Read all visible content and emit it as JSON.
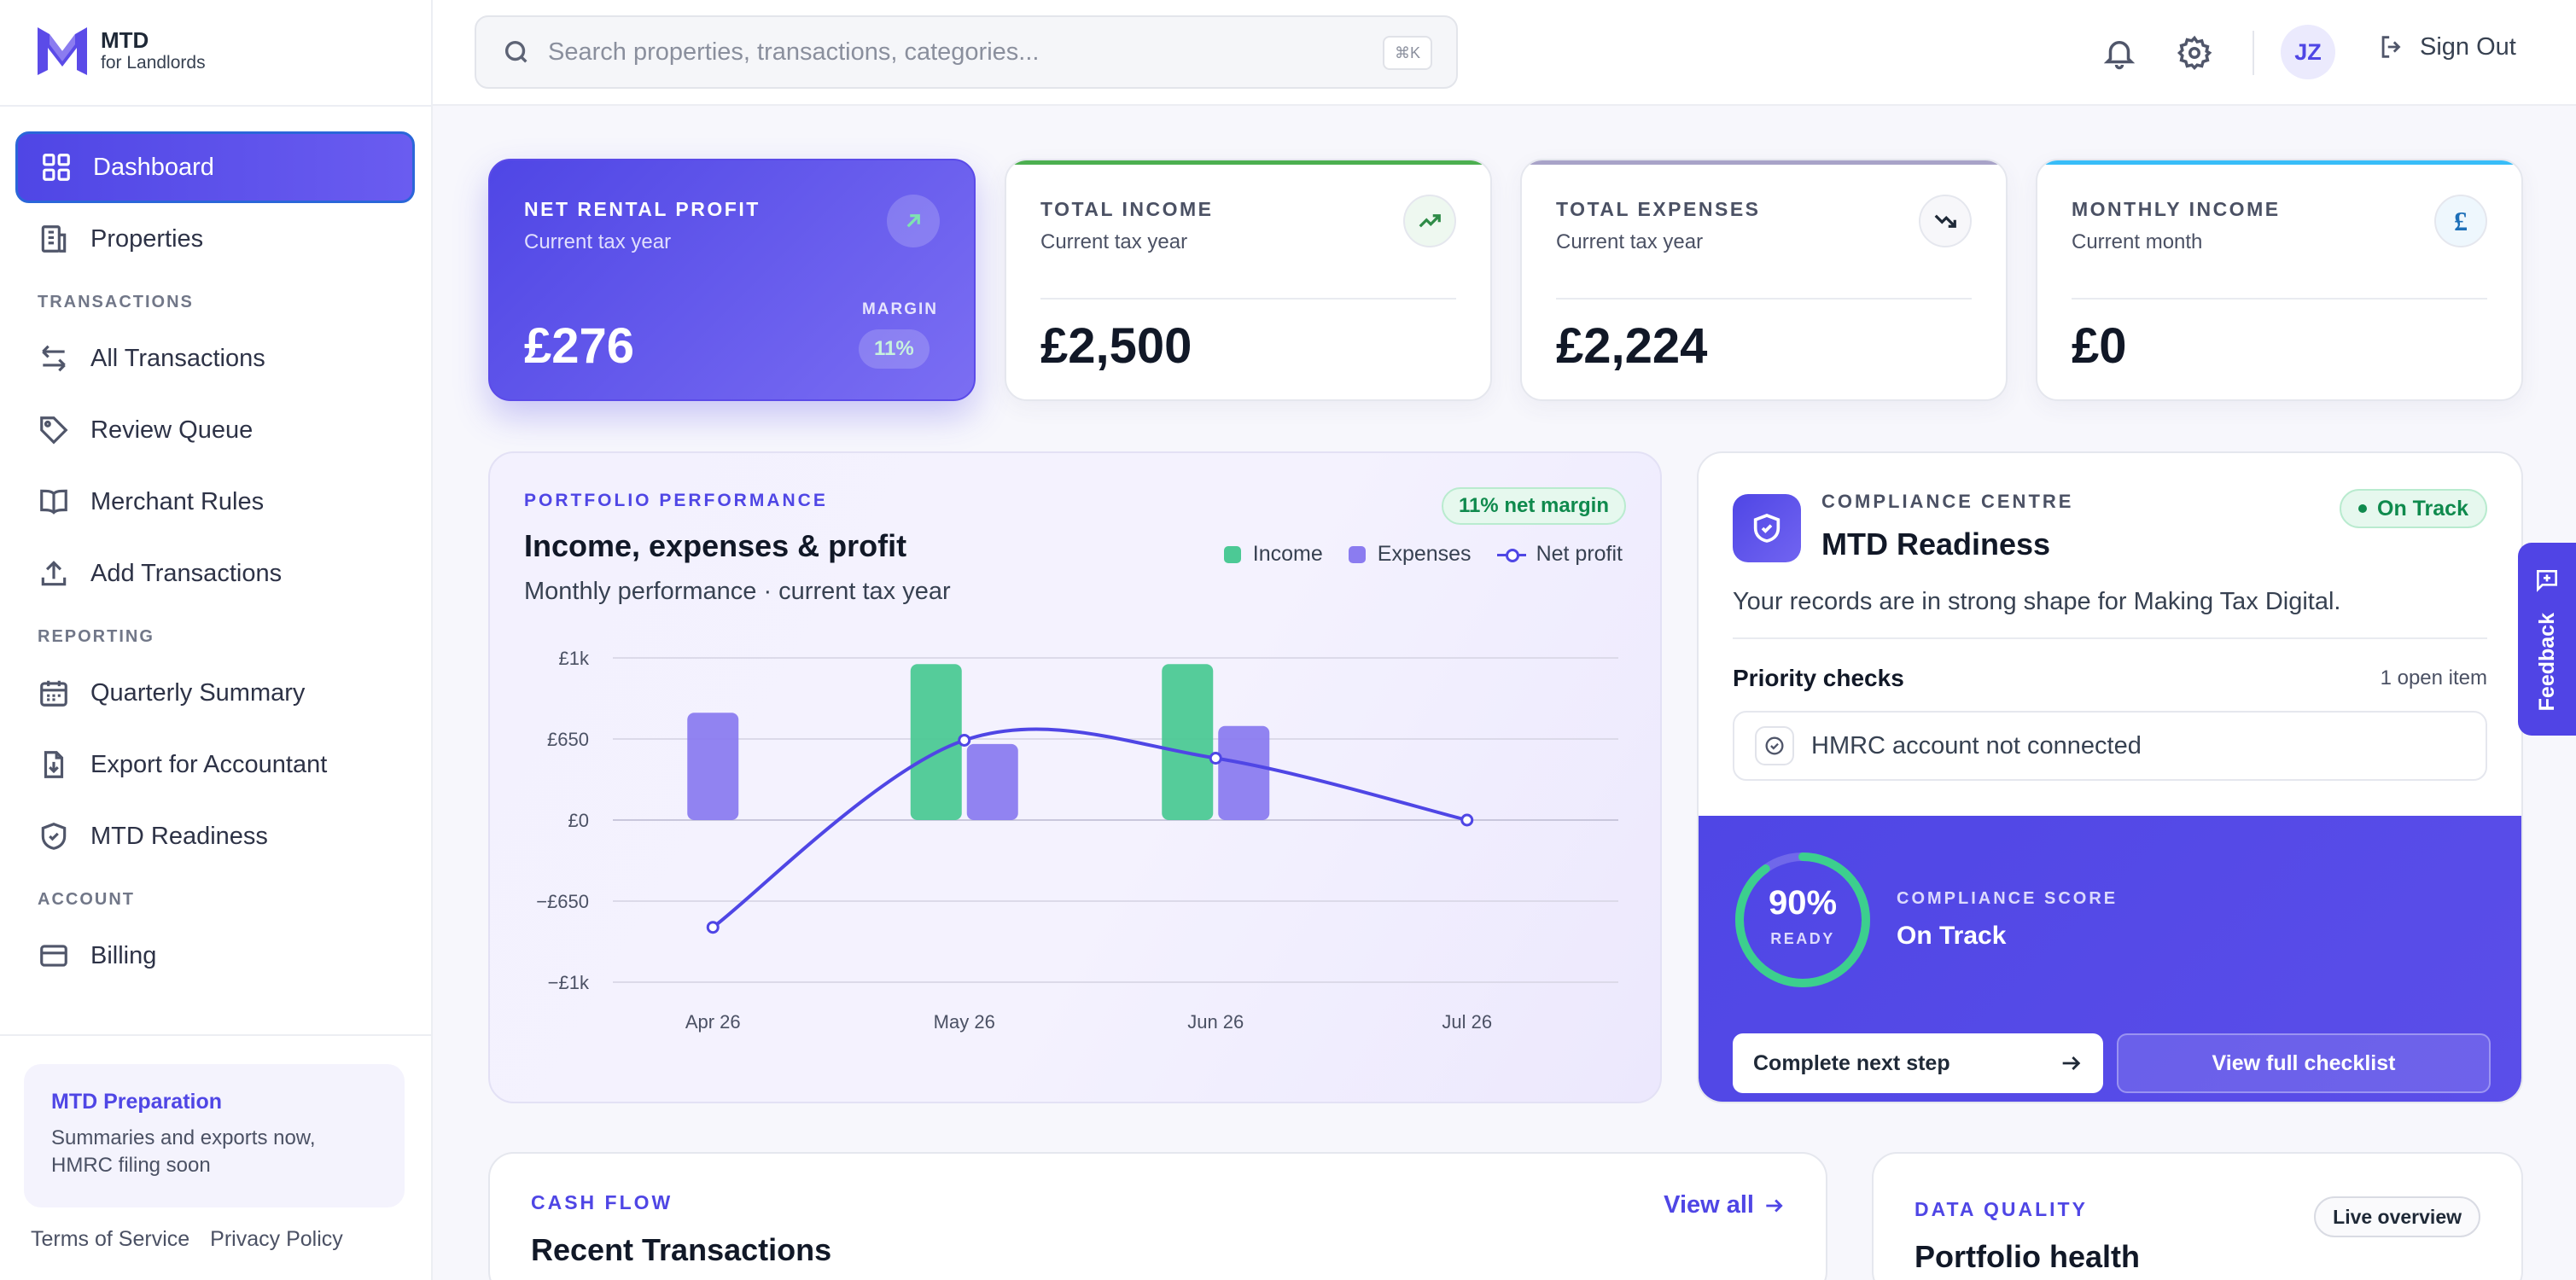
{
  "brand": {
    "name": "MTD",
    "subtitle": "for Landlords"
  },
  "search": {
    "placeholder": "Search properties, transactions, categories...",
    "shortcut": "⌘K"
  },
  "header": {
    "avatar_initials": "JZ",
    "sign_out_label": "Sign Out"
  },
  "sidebar": {
    "primary": [
      {
        "label": "Dashboard",
        "icon": "grid-icon",
        "active": true
      },
      {
        "label": "Properties",
        "icon": "building-icon"
      }
    ],
    "sections": [
      {
        "title": "TRANSACTIONS",
        "items": [
          {
            "label": "All Transactions",
            "icon": "arrows-swap-icon"
          },
          {
            "label": "Review Queue",
            "icon": "tag-icon"
          },
          {
            "label": "Merchant Rules",
            "icon": "book-icon"
          },
          {
            "label": "Add Transactions",
            "icon": "upload-icon"
          }
        ]
      },
      {
        "title": "REPORTING",
        "items": [
          {
            "label": "Quarterly Summary",
            "icon": "calendar-icon"
          },
          {
            "label": "Export for Accountant",
            "icon": "file-download-icon"
          },
          {
            "label": "MTD Readiness",
            "icon": "shield-check-icon"
          }
        ]
      },
      {
        "title": "ACCOUNT",
        "items": [
          {
            "label": "Billing",
            "icon": "credit-card-icon"
          }
        ]
      }
    ],
    "prep_card": {
      "title": "MTD Preparation",
      "text": "Summaries and exports now, HMRC filing soon"
    },
    "footer": {
      "terms": "Terms of Service",
      "privacy": "Privacy Policy"
    }
  },
  "stats": [
    {
      "label": "NET RENTAL PROFIT",
      "sub": "Current tax year",
      "value": "£276",
      "margin_label": "MARGIN",
      "margin_value": "11%",
      "icon": "arrow-up-right-icon"
    },
    {
      "label": "TOTAL INCOME",
      "sub": "Current tax year",
      "value": "£2,500",
      "icon": "trending-up-icon",
      "accent": "#4caf50"
    },
    {
      "label": "TOTAL EXPENSES",
      "sub": "Current tax year",
      "value": "£2,224",
      "icon": "trending-down-icon",
      "accent": "#a8a3c8"
    },
    {
      "label": "MONTHLY INCOME",
      "sub": "Current month",
      "value": "£0",
      "icon": "pound-icon",
      "accent": "#38bdf8"
    }
  ],
  "performance": {
    "kicker": "PORTFOLIO PERFORMANCE",
    "title": "Income, expenses & profit",
    "subtitle": "Monthly performance · current tax year",
    "badge": "11% net margin",
    "legend": {
      "income": "Income",
      "expenses": "Expenses",
      "net": "Net profit"
    }
  },
  "chart_data": {
    "type": "bar",
    "categories": [
      "Apr 26",
      "May 26",
      "Jun 26",
      "Jul 26"
    ],
    "series": [
      {
        "name": "Income",
        "kind": "bar",
        "color": "#4cc995",
        "values": [
          0,
          1250,
          1250,
          0
        ]
      },
      {
        "name": "Expenses",
        "kind": "bar",
        "color": "#8b7cf0",
        "values": [
          860,
          610,
          754,
          0
        ]
      },
      {
        "name": "Net profit",
        "kind": "line",
        "color": "#4f46e5",
        "values": [
          -860,
          640,
          496,
          0
        ]
      }
    ],
    "ylim": [
      -1300,
      1300
    ],
    "yticks": [
      1300,
      650,
      0,
      -650,
      -1300
    ],
    "ytick_labels": [
      "£1k",
      "£650",
      "£0",
      "−£650",
      "−£1k"
    ],
    "grid": true,
    "legend_position": "top-right"
  },
  "compliance": {
    "kicker": "COMPLIANCE CENTRE",
    "title": "MTD Readiness",
    "status": "On Track",
    "description": "Your records are in strong shape for Making Tax Digital.",
    "priority_title": "Priority checks",
    "priority_count": "1 open item",
    "priority_items": [
      "HMRC account not connected"
    ],
    "score_value": 90,
    "score_label": "90%",
    "score_ready": "READY",
    "score_kicker": "COMPLIANCE SCORE",
    "score_status": "On Track",
    "btn_next": "Complete next step",
    "btn_full": "View full checklist"
  },
  "feedback": {
    "label": "Feedback"
  },
  "cashflow": {
    "kicker": "CASH FLOW",
    "title": "Recent Transactions",
    "view_all": "View all"
  },
  "data_quality": {
    "kicker": "DATA QUALITY",
    "title": "Portfolio health",
    "pill": "Live overview"
  }
}
